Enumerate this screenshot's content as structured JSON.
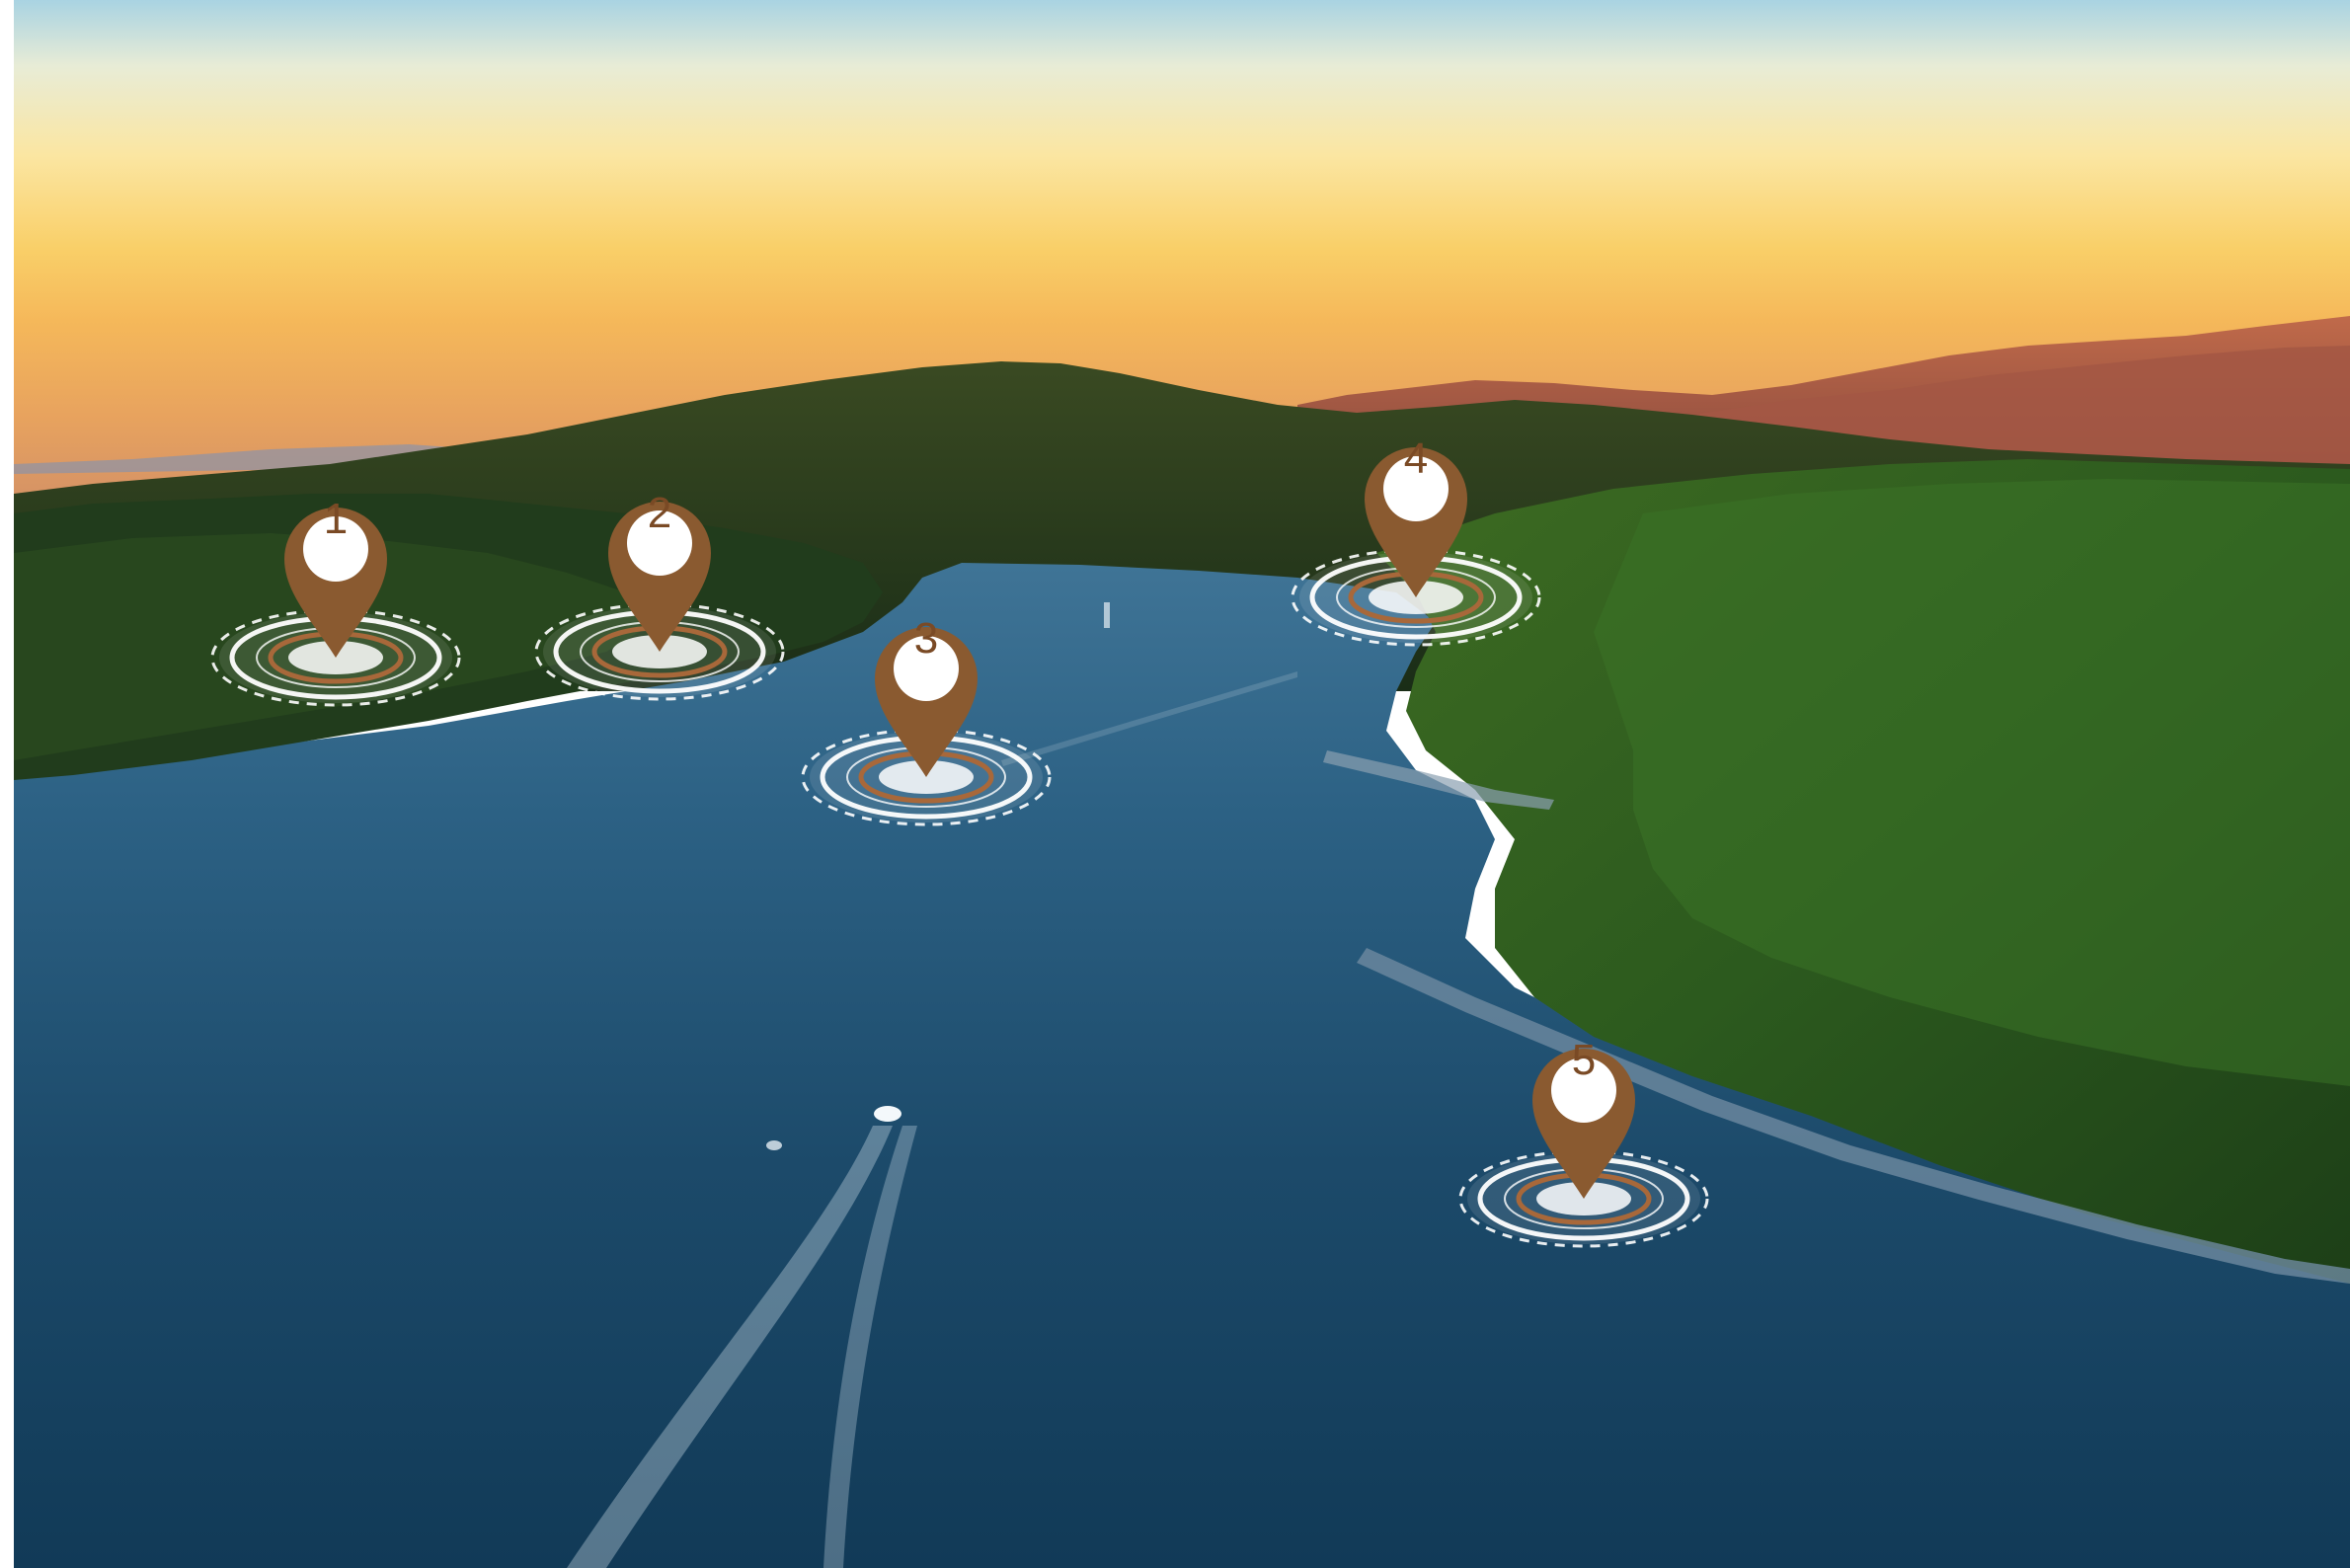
{
  "map": {
    "colors": {
      "pin": "#8a5a30",
      "pin_label_circle": "#ffffff",
      "pin_label_text": "#7a4a25",
      "ring": "#ffffff",
      "ring_accent": "#a8683a",
      "water": "#1f4e6e",
      "forest": "#1f3a1a",
      "sky_top": "#a9d3e2",
      "sky_bottom": "#f7b74c",
      "mountains": "#b65e45"
    },
    "markers": [
      {
        "label": "1",
        "icon": "map-pin-icon"
      },
      {
        "label": "2",
        "icon": "map-pin-icon"
      },
      {
        "label": "3",
        "icon": "map-pin-icon"
      },
      {
        "label": "4",
        "icon": "map-pin-icon"
      },
      {
        "label": "5",
        "icon": "map-pin-icon"
      }
    ]
  }
}
